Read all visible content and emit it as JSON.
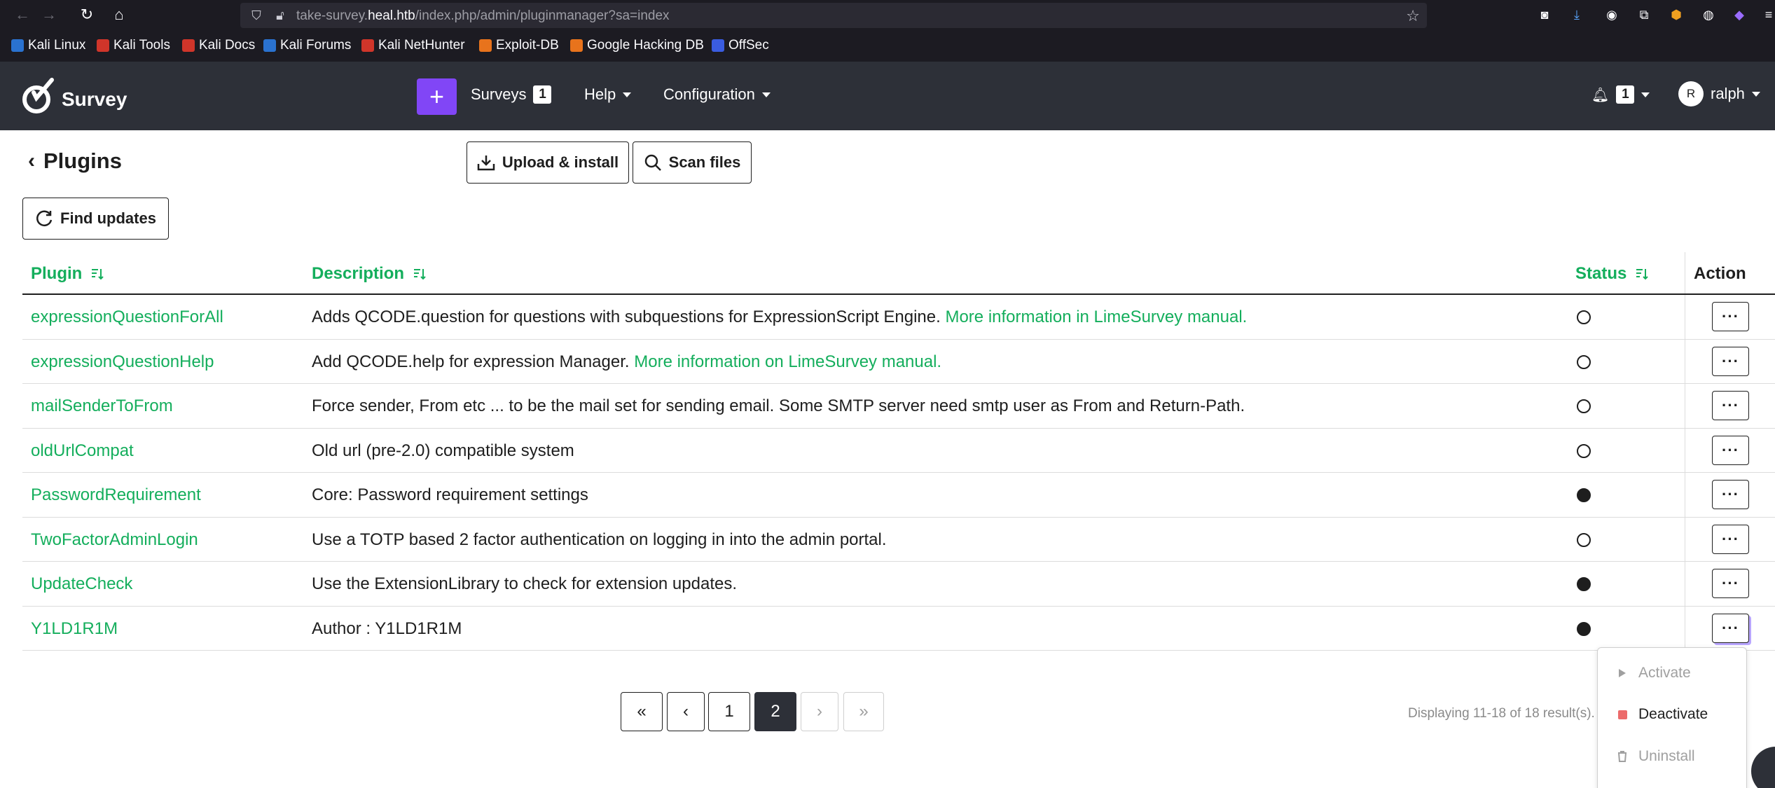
{
  "browser": {
    "url_prefix": "take-survey.",
    "url_domain": "heal.htb",
    "url_path": "/index.php/admin/pluginmanager?sa=index",
    "bookmarks": [
      {
        "label": "Kali Linux",
        "color": "#2a72d0"
      },
      {
        "label": "Kali Tools",
        "color": "#d0352a"
      },
      {
        "label": "Kali Docs",
        "color": "#d0352a"
      },
      {
        "label": "Kali Forums",
        "color": "#2a72d0"
      },
      {
        "label": "Kali NetHunter",
        "color": "#d0352a"
      },
      {
        "label": "Exploit-DB",
        "color": "#e8731c"
      },
      {
        "label": "Google Hacking DB",
        "color": "#e8731c"
      },
      {
        "label": "OffSec",
        "color": "#3a5ce0"
      }
    ]
  },
  "app": {
    "brand": "Survey",
    "accent": "#8146f6",
    "green": "#14ae5c",
    "menu": {
      "surveys_label": "Surveys",
      "surveys_count": "1",
      "help_label": "Help",
      "config_label": "Configuration",
      "notif_count": "1",
      "user_initial": "R",
      "user_name": "ralph"
    }
  },
  "page": {
    "title": "Plugins",
    "upload_label": "Upload & install",
    "scan_label": "Scan files",
    "find_updates_label": "Find updates"
  },
  "table": {
    "headers": {
      "plugin": "Plugin",
      "description": "Description",
      "status": "Status",
      "action": "Action"
    },
    "rows": [
      {
        "name": "expressionQuestionForAll",
        "desc": "Adds QCODE.question for questions with subquestions for ExpressionScript Engine. ",
        "link": "More information in LimeSurvey manual.",
        "active": false
      },
      {
        "name": "expressionQuestionHelp",
        "desc": "Add QCODE.help for expression Manager. ",
        "link": "More information on LimeSurvey manual.",
        "active": false
      },
      {
        "name": "mailSenderToFrom",
        "desc": "Force sender, From etc ... to be the mail set for sending email. Some SMTP server need smtp user as From and Return-Path.",
        "link": "",
        "active": false
      },
      {
        "name": "oldUrlCompat",
        "desc": "Old url (pre-2.0) compatible system",
        "link": "",
        "active": false
      },
      {
        "name": "PasswordRequirement",
        "desc": "Core: Password requirement settings",
        "link": "",
        "active": true
      },
      {
        "name": "TwoFactorAdminLogin",
        "desc": "Use a TOTP based 2 factor authentication on logging in into the admin portal.",
        "link": "",
        "active": false
      },
      {
        "name": "UpdateCheck",
        "desc": "Use the ExtensionLibrary to check for extension updates.",
        "link": "",
        "active": true
      },
      {
        "name": "Y1LD1R1M",
        "desc": "Author : Y1LD1R1M",
        "link": "",
        "active": true
      }
    ],
    "action_label": "···"
  },
  "pagination": {
    "first": "«",
    "prev": "‹",
    "pages": [
      "1",
      "2"
    ],
    "current": "2",
    "next": "›",
    "last": "»",
    "summary": "Displaying 11-18 of 18 result(s)."
  },
  "dropdown": {
    "activate": "Activate",
    "deactivate": "Deactivate",
    "uninstall": "Uninstall"
  }
}
